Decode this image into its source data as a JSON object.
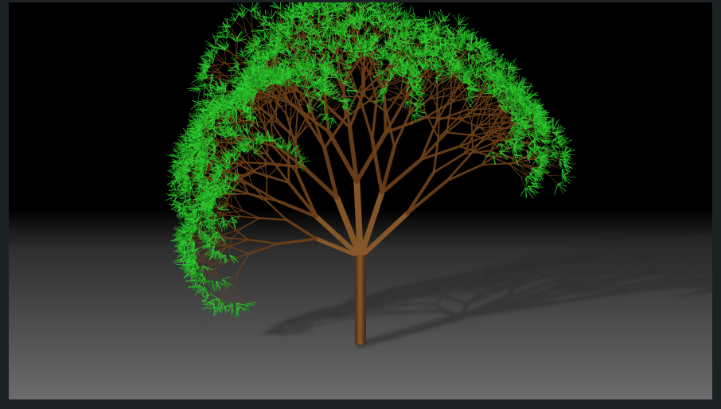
{
  "scene": {
    "description_icon": "tree-icon",
    "colors": {
      "frame": "#1c2224",
      "sky_top": "#000000",
      "ground_near": "#6e6e6e",
      "ground_far": "#3a3a3a",
      "trunk": "#6a3f18",
      "trunk_highlight": "#8a5a2a",
      "leaf": "#2ecc2e",
      "leaf_dark": "#1a8a1a",
      "shadow": "#2a2a2a"
    }
  }
}
